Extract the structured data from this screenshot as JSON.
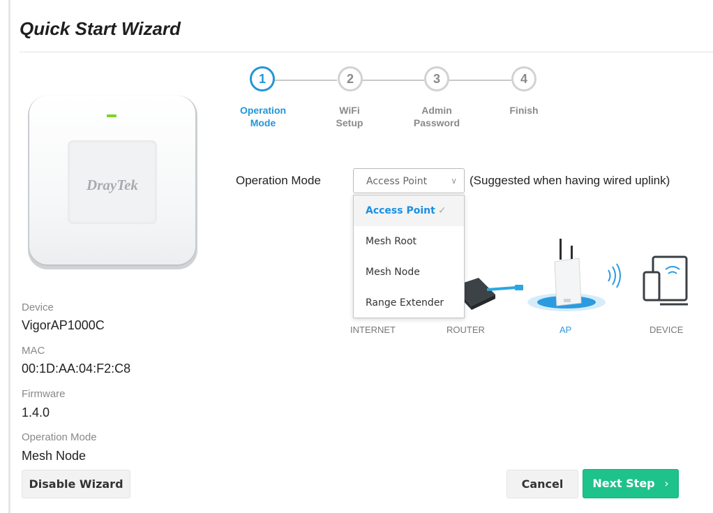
{
  "page": {
    "title": "Quick Start Wizard"
  },
  "device_image": {
    "brand": "DrayTek"
  },
  "device_info": {
    "device_label": "Device",
    "device_value": "VigorAP1000C",
    "mac_label": "MAC",
    "mac_value": "00:1D:AA:04:F2:C8",
    "firmware_label": "Firmware",
    "firmware_value": "1.4.0",
    "mode_label": "Operation Mode",
    "mode_value": "Mesh Node"
  },
  "steps": [
    {
      "number": "1",
      "line1": "Operation",
      "line2": "Mode",
      "active": true
    },
    {
      "number": "2",
      "line1": "WiFi",
      "line2": "Setup",
      "active": false
    },
    {
      "number": "3",
      "line1": "Admin",
      "line2": "Password",
      "active": false
    },
    {
      "number": "4",
      "line1": "Finish",
      "line2": "",
      "active": false
    }
  ],
  "operation": {
    "label": "Operation Mode",
    "selected": "Access Point",
    "hint": "(Suggested when having wired uplink)",
    "options": [
      "Access Point",
      "Mesh Root",
      "Mesh Node",
      "Range Extender"
    ]
  },
  "diagram": {
    "labels": [
      "INTERNET",
      "ROUTER",
      "AP",
      "DEVICE"
    ],
    "colors": {
      "accent": "#2196d9",
      "cable": "#29a8e0"
    }
  },
  "buttons": {
    "disable_wizard": "Disable Wizard",
    "cancel": "Cancel",
    "next": "Next Step",
    "next_icon": "chevron-right-icon"
  },
  "colors": {
    "primary": "#2196d9",
    "success": "#1ec28b",
    "led": "#7ed321"
  }
}
